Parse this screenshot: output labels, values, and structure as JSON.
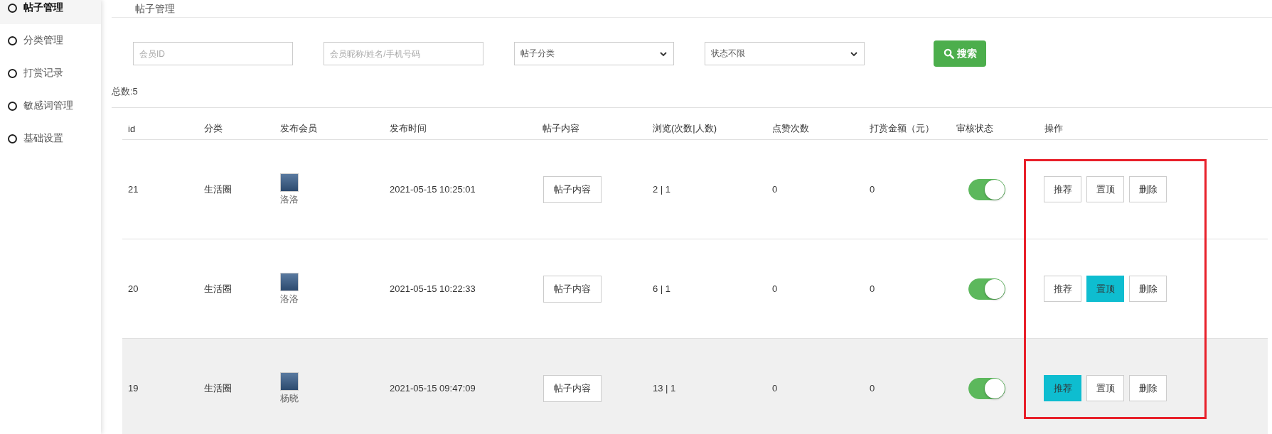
{
  "sidebar": {
    "items": [
      {
        "label": "帖子管理",
        "selected": true
      },
      {
        "label": "分类管理",
        "selected": false
      },
      {
        "label": "打赏记录",
        "selected": false
      },
      {
        "label": "敏感词管理",
        "selected": false
      },
      {
        "label": "基础设置",
        "selected": false
      }
    ]
  },
  "breadcrumb": "帖子管理",
  "filters": [
    {
      "kind": "input",
      "placeholder": "会员ID"
    },
    {
      "kind": "input",
      "placeholder": "会员昵称/姓名/手机号码"
    },
    {
      "kind": "select",
      "value": "帖子分类"
    },
    {
      "kind": "select",
      "value": "状态不限"
    }
  ],
  "search_button": "搜索",
  "total": "总数:5",
  "table": {
    "columns": [
      "id",
      "分类",
      "发布会员",
      "发布时间",
      "帖子内容",
      "浏览(次数|人数)",
      "点赞次数",
      "打赏金额（元）",
      "审核状态",
      "操作"
    ],
    "rows": [
      {
        "id": "21",
        "category": "生活圈",
        "member": "洛洛",
        "time": "2021-05-15 10:25:01",
        "content": "帖子内容",
        "views": "2 | 1",
        "likes": "0",
        "reward": "0",
        "approved": true,
        "hovered": false,
        "actions": [
          {
            "label": "推荐",
            "selected": false
          },
          {
            "label": "置顶",
            "selected": false
          },
          {
            "label": "删除",
            "selected": false
          }
        ]
      },
      {
        "id": "20",
        "category": "生活圈",
        "member": "洛洛",
        "time": "2021-05-15 10:22:33",
        "content": "帖子内容",
        "views": "6 | 1",
        "likes": "0",
        "reward": "0",
        "approved": true,
        "hovered": false,
        "actions": [
          {
            "label": "推荐",
            "selected": false
          },
          {
            "label": "置顶",
            "selected": true
          },
          {
            "label": "删除",
            "selected": false
          }
        ]
      },
      {
        "id": "19",
        "category": "生活圈",
        "member": "杨晓",
        "time": "2021-05-15 09:47:09",
        "content": "帖子内容",
        "views": "13 | 1",
        "likes": "0",
        "reward": "0",
        "approved": true,
        "hovered": true,
        "actions": [
          {
            "label": "推荐",
            "selected": true
          },
          {
            "label": "置顶",
            "selected": false
          },
          {
            "label": "删除",
            "selected": false
          }
        ]
      }
    ]
  }
}
